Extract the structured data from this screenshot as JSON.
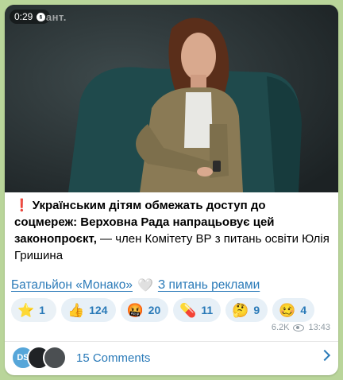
{
  "video": {
    "duration": "0:29",
    "watermark": "сант."
  },
  "post": {
    "headline": "Українським дітям обмежать доступ до соцмереж: Верховна Рада напрацьовує цей законопроєкт,",
    "body": " — член Комітету ВР з питань освіти Юлія Гришина"
  },
  "links": {
    "channel": "Батальйон «Монако»",
    "ads": "З питань реклами"
  },
  "reactions": [
    {
      "icon": "star-icon",
      "glyph": "⭐",
      "count": "1"
    },
    {
      "icon": "thumbs-up-icon",
      "glyph": "👍",
      "count": "124"
    },
    {
      "icon": "angry-face-icon",
      "glyph": "🤬",
      "count": "20"
    },
    {
      "icon": "pill-icon",
      "glyph": "💊",
      "count": "11"
    },
    {
      "icon": "thinking-face-icon",
      "glyph": "🤔",
      "count": "9"
    },
    {
      "icon": "woozy-face-icon",
      "glyph": "🥴",
      "count": "4"
    }
  ],
  "meta": {
    "views": "6.2K",
    "time": "13:43"
  },
  "comments": {
    "avatar_initials": "DS",
    "label": "15 Comments"
  },
  "colors": {
    "background": "#b9d59a",
    "accent": "#2a7ab8",
    "exclamation": "#e0262b"
  }
}
